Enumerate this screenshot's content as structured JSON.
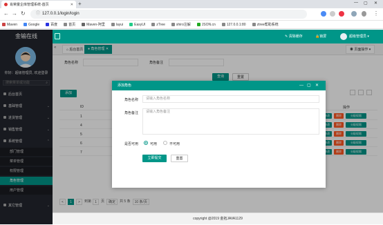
{
  "browser": {
    "tab_title": "肖荣童企库管理系统-首页",
    "url": "127.0.0.1/login/login",
    "bookmarks": [
      "Maven",
      "Google",
      "百度",
      "首页",
      "Maven-阿里",
      "layui",
      "EasyUI",
      "zTree",
      "shiro注解",
      "JSON.cn",
      "127.0.0.1:80",
      "ztree帮助系统"
    ]
  },
  "app": {
    "logo": "金输在线",
    "welcome": "你好：超级管理员, 欢迎登录",
    "search_placeholder": "搜索菜单或功能",
    "nav": [
      "后台首页",
      "基础管理",
      "进货管理",
      "销售管理",
      "系统管理",
      "其它管理"
    ],
    "sub_nav": [
      "部门管理",
      "菜单管理",
      "权限管理",
      "角色管理",
      "用户管理"
    ],
    "top_right": {
      "clear": "清除缓存",
      "lock": "锁屏",
      "user": "超级管理员"
    },
    "tabs": [
      "后台首页",
      "角色管理"
    ],
    "page_ops": "页面操作"
  },
  "filter": {
    "name_label": "角色名称",
    "remark_label": "角色备注",
    "search_btn": "查询",
    "reset_btn": "重置"
  },
  "table": {
    "add_btn": "添加",
    "col_id": "ID",
    "col_ops": "操作",
    "ids": [
      "1",
      "4",
      "5",
      "6",
      "7"
    ],
    "ops": [
      "修改",
      "删除",
      "分配权限"
    ]
  },
  "pager": {
    "prev": "<",
    "page": "1",
    "next": ">",
    "goto": "到第",
    "page_val": "1",
    "page_unit": "页",
    "confirm": "确定",
    "total": "共 5 条",
    "size": "10 条/页"
  },
  "modal": {
    "title": "添加角色",
    "name_label": "角色名称",
    "name_placeholder": "请输入角色名称",
    "remark_label": "角色备注",
    "remark_placeholder": "请输入角色备注",
    "avail_label": "是否可用",
    "opt_yes": "可用",
    "opt_no": "不可用",
    "submit": "立即提交",
    "reset": "重置"
  },
  "footer": "copyright @2019 金拓JAVA1129",
  "colors": {
    "primary": "#009688",
    "danger": "#ff5722",
    "sidebar": "#23262e"
  }
}
